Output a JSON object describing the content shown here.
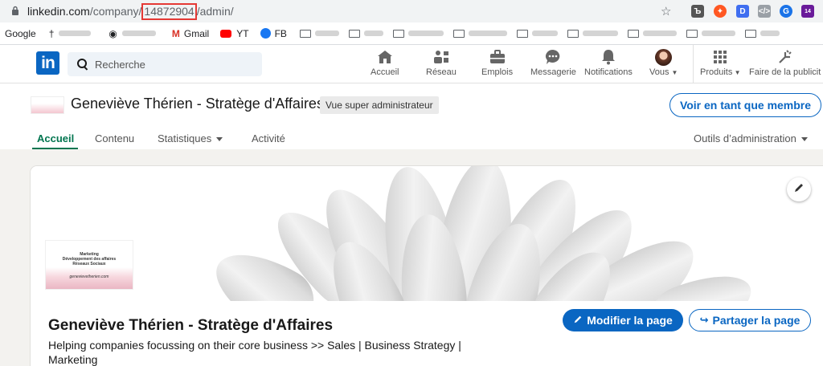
{
  "browser": {
    "url_prefix": "linkedin.com",
    "url_path_start": "/company/",
    "url_highlight": "14872904",
    "url_path_end": "/admin/",
    "extensions_badge": "14"
  },
  "bookmarks": [
    {
      "label": "Google",
      "type": "text"
    },
    {
      "label": "",
      "type": "blur",
      "icon": "cross-icon"
    },
    {
      "label": "",
      "type": "blur",
      "icon": "globe-icon"
    },
    {
      "label": "Gmail",
      "type": "text",
      "icon": "gmail-icon"
    },
    {
      "label": "YT",
      "type": "text",
      "icon": "youtube-icon"
    },
    {
      "label": "FB",
      "type": "text",
      "icon": "facebook-icon"
    },
    {
      "label": "",
      "type": "blur",
      "icon": "folder-icon"
    },
    {
      "label": "",
      "type": "blur",
      "icon": "folder-icon"
    },
    {
      "label": "",
      "type": "blur",
      "icon": "folder-icon"
    },
    {
      "label": "",
      "type": "blur",
      "icon": "folder-icon"
    },
    {
      "label": "",
      "type": "blur",
      "icon": "folder-icon"
    },
    {
      "label": "",
      "type": "blur",
      "icon": "folder-icon"
    },
    {
      "label": "",
      "type": "blur",
      "icon": "folder-icon"
    },
    {
      "label": "",
      "type": "blur",
      "icon": "folder-icon"
    },
    {
      "label": "",
      "type": "blur",
      "icon": "folder-icon"
    }
  ],
  "nav": {
    "logo": "in",
    "search_placeholder": "Recherche",
    "items": [
      {
        "label": "Accueil",
        "icon": "home-icon"
      },
      {
        "label": "Réseau",
        "icon": "network-icon"
      },
      {
        "label": "Emplois",
        "icon": "briefcase-icon"
      },
      {
        "label": "Messagerie",
        "icon": "messaging-icon"
      },
      {
        "label": "Notifications",
        "icon": "bell-icon"
      },
      {
        "label": "Vous",
        "icon": "avatar-icon"
      },
      {
        "label": "Produits",
        "icon": "grid-icon"
      },
      {
        "label": "Faire de la publicit",
        "icon": "ads-icon"
      }
    ]
  },
  "company": {
    "name": "Geneviève Thérien - Stratège d'Affaires",
    "badge": "Vue super administrateur",
    "view_as_button": "Voir en tant que membre",
    "tabs": [
      "Accueil",
      "Contenu",
      "Statistiques",
      "Activité"
    ],
    "admin_tools": "Outils d’administration"
  },
  "card": {
    "name": "Geneviève Thérien - Stratège d'Affaires",
    "tagline": "Helping companies focussing on their core business >> Sales | Business Strategy | Marketing",
    "logo_lines": [
      "Marketing",
      "Développement des affaires",
      "Réseaux Sociaux"
    ],
    "logo_signature": "genevievetherien.com",
    "edit_button": "Modifier la page",
    "share_button": "Partager la page"
  },
  "colors": {
    "linkedin_blue": "#0a66c2",
    "active_tab": "#01754f",
    "highlight_border": "#e53935"
  }
}
